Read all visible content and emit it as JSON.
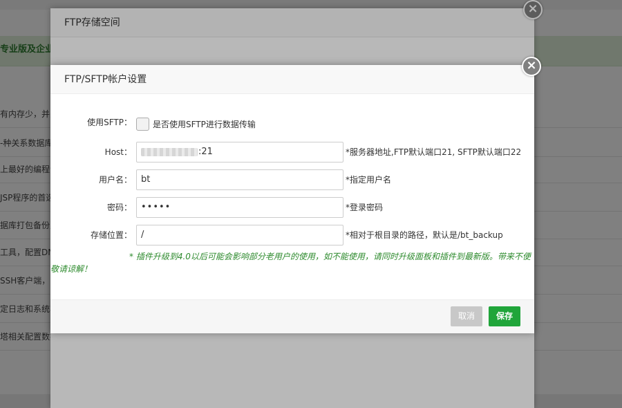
{
  "background": {
    "banner_text": "专业版及企业",
    "rows": [
      "有内存少，并另",
      "-种关系数据库",
      "上最好的编程语",
      "JSP程序的首选",
      "据库打包备份至",
      "工具，配置DNS",
      "SSH客户端，",
      "定日志和系统状",
      "塔相关配置数据"
    ]
  },
  "dialog1": {
    "title": "FTP存储空间",
    "close_label": "×"
  },
  "dialog2": {
    "title": "FTP/SFTP帐户设置",
    "close_label": "×",
    "sftp": {
      "label": "使用SFTP：",
      "checkbox_label": "是否使用SFTP进行数据传输",
      "checked": false
    },
    "host": {
      "label": "Host：",
      "value_suffix": ":21",
      "hint": "*服务器地址,FTP默认端口21, SFTP默认端口22"
    },
    "username": {
      "label": "用户名：",
      "value": "bt",
      "hint": "*指定用户名"
    },
    "password": {
      "label": "密码：",
      "value": "•••••",
      "hint": "*登录密码"
    },
    "path": {
      "label": "存储位置：",
      "value": "/",
      "hint": "*相对于根目录的路径，默认是/bt_backup"
    },
    "warning": "* 插件升级到4.0以后可能会影响部分老用户的使用，如不能使用，请同时升级面板和插件到最新版。带来不便敬请谅解！",
    "buttons": {
      "cancel": "取消",
      "save": "保存"
    }
  },
  "colors": {
    "primary_green": "#20a53a",
    "warning_green": "#2e8b2e",
    "cancel_gray": "#c8c8c8"
  }
}
